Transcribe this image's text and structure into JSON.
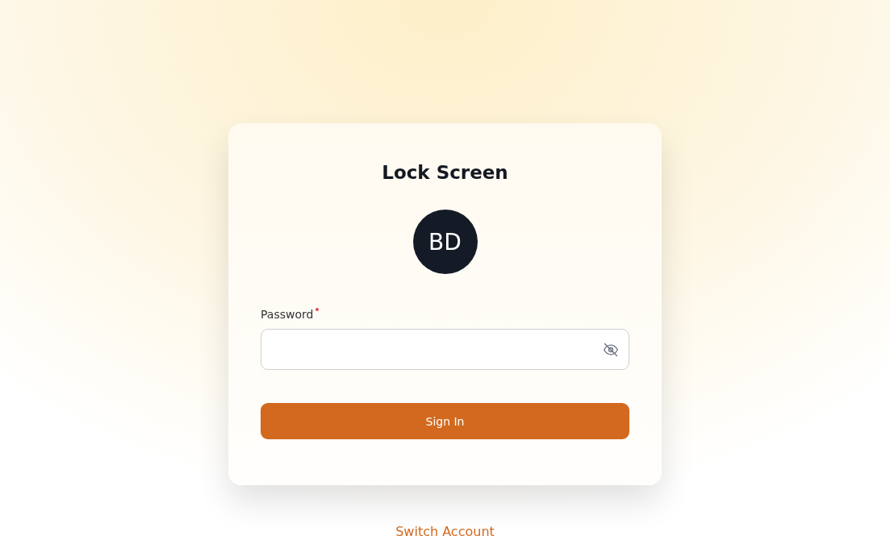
{
  "card": {
    "title": "Lock Screen",
    "avatar_initials": "BD"
  },
  "password": {
    "label": "Password",
    "required": true,
    "password_visible": false
  },
  "sign_in_button": "Sign In",
  "switch_account_link": "Switch Account"
}
